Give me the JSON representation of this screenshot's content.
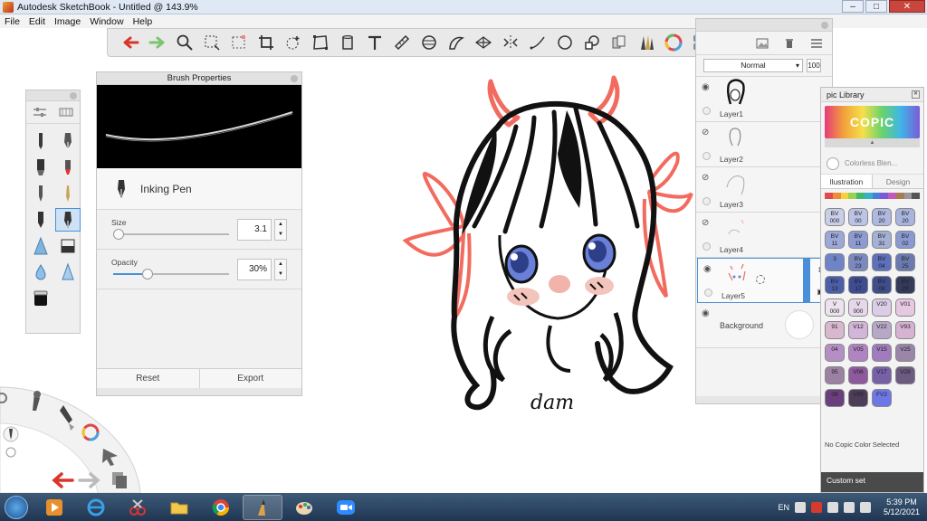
{
  "window": {
    "title": "Autodesk SketchBook - Untitled @ 143.9%",
    "min": "–",
    "max": "□",
    "close": "✕"
  },
  "menu": [
    "File",
    "Edit",
    "Image",
    "Window",
    "Help"
  ],
  "toolbar": {
    "icons": [
      "undo-icon",
      "redo-icon",
      "zoom-icon",
      "select-icon",
      "select-lasso-icon",
      "crop-icon",
      "transform-icon",
      "distort-icon",
      "fill-icon",
      "text-icon",
      "ruler-icon",
      "ellipse-guide-icon",
      "french-curve-icon",
      "perspective-icon",
      "symmetry-icon",
      "line-icon",
      "ellipse-icon",
      "shape-icon",
      "copic-markers-icon",
      "brush-library-icon",
      "color-wheel-icon",
      "layers-toggle-icon"
    ],
    "colors": {
      "undo": "#d9352b",
      "redo": "#7cc46f"
    }
  },
  "brush_panel": {
    "title": "Brush Properties",
    "brush_name": "Inking Pen",
    "size_label": "Size",
    "size_value": "3.1",
    "size_level": 0.05,
    "opacity_label": "Opacity",
    "opacity_value": "30%",
    "opacity_level": 0.3,
    "reset_label": "Reset",
    "export_label": "Export"
  },
  "layers": {
    "blend_mode": "Normal",
    "opacity": "100",
    "items": [
      {
        "name": "Layer1"
      },
      {
        "name": "Layer2"
      },
      {
        "name": "Layer3"
      },
      {
        "name": "Layer4"
      },
      {
        "name": "Layer5"
      },
      {
        "name": "Background"
      }
    ]
  },
  "drawing": {
    "signature": "dam",
    "line_color": "#111111",
    "accent_color": "#f26b5e"
  },
  "copic": {
    "title": "pic Library",
    "logo_text": "COPIC",
    "blender_text": "Colorless Blen...",
    "tab_illustration": "llustration",
    "tab_design": "Design",
    "no_color": "No Copic Color Selected",
    "custom_set": "Custom set",
    "chips": [
      {
        "label": "BV\n000",
        "color": "#c9cfe9"
      },
      {
        "label": "BV\n00",
        "color": "#bcc4e5"
      },
      {
        "label": "BV\n20",
        "color": "#aeb8e0"
      },
      {
        "label": "BV\n20",
        "color": "#a8b4de"
      },
      {
        "label": "BV\n11",
        "color": "#9ba8d8"
      },
      {
        "label": "BV\n11",
        "color": "#8c9bd2"
      },
      {
        "label": "BV\n31",
        "color": "#a5b0d5"
      },
      {
        "label": "BV\n02",
        "color": "#8a9ad1"
      },
      {
        "label": "3",
        "color": "#6f84c8"
      },
      {
        "label": "BV\n23",
        "color": "#7a8ac1"
      },
      {
        "label": "BV\n04",
        "color": "#5c70bb"
      },
      {
        "label": "BV\n25",
        "color": "#6a7aaf"
      },
      {
        "label": "BV\n13",
        "color": "#4b5fa8"
      },
      {
        "label": "BV\n17",
        "color": "#3e4d92"
      },
      {
        "label": "BV\n08",
        "color": "#404d8b"
      },
      {
        "label": "BV\n29",
        "color": "#333a5a"
      },
      {
        "label": "V\n000",
        "color": "#ece3ef"
      },
      {
        "label": "V\n000",
        "color": "#e6d8ea"
      },
      {
        "label": "V20",
        "color": "#dccde6"
      },
      {
        "label": "V01",
        "color": "#e6c8e3"
      },
      {
        "label": "91",
        "color": "#d9b7cf"
      },
      {
        "label": "V12",
        "color": "#d2b5d8"
      },
      {
        "label": "V22",
        "color": "#b8a8c8"
      },
      {
        "label": "V93",
        "color": "#d7b3d3"
      },
      {
        "label": "04",
        "color": "#b58ec6"
      },
      {
        "label": "V05",
        "color": "#b183c2"
      },
      {
        "label": "V15",
        "color": "#a07cbf"
      },
      {
        "label": "V25",
        "color": "#9a86a9"
      },
      {
        "label": "95",
        "color": "#9c81a2"
      },
      {
        "label": "V06",
        "color": "#8e5a9d"
      },
      {
        "label": "V17",
        "color": "#7660a8"
      },
      {
        "label": "V28",
        "color": "#6c5a80"
      },
      {
        "label": "09",
        "color": "#6a3f7d"
      },
      {
        "label": "V99",
        "color": "#4d3d59"
      },
      {
        "label": "FV2",
        "color": "#6f77e6"
      }
    ]
  },
  "taskbar": {
    "language": "EN",
    "time": "5:39 PM",
    "date": "5/12/2021",
    "apps": [
      "file-explorer-icon",
      "internet-explorer-icon",
      "snipping-tool-icon",
      "folder-icon",
      "chrome-icon",
      "sketchbook-icon",
      "paint-icon",
      "zoom-icon"
    ]
  }
}
